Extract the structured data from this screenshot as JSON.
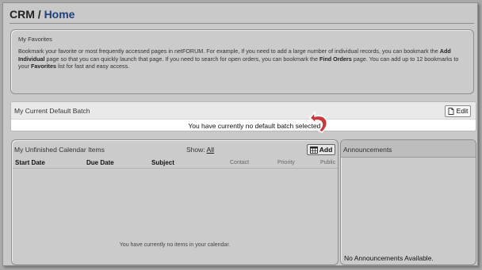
{
  "header": {
    "section": "CRM",
    "separator": " / ",
    "page": "Home"
  },
  "favorites": {
    "title": "My Favorites",
    "desc_1": "Bookmark your favorite or most frequently accessed pages in netFORUM. For example, If you need to add a large number of individual records, you can bookmark the ",
    "desc_add": "Add Individual",
    "desc_2": " page so that you can quickly launch that page. If you need to search for open orders, you can bookmark the ",
    "desc_find": "Find Orders",
    "desc_3": " page. You can add up to 12 bookmarks to your ",
    "desc_fav": "Favorites",
    "desc_4": " list for fast and easy access."
  },
  "batch": {
    "title": "My Current Default Batch",
    "edit_label": "Edit",
    "message": "You have currently no default batch selected."
  },
  "calendar": {
    "title": "My Unfinished Calendar Items",
    "show_label": "Show:",
    "show_value": "All",
    "add_label": "Add",
    "columns": [
      "Start Date",
      "Due Date",
      "Subject",
      "Contact",
      "Priority",
      "Public"
    ],
    "empty_message": "You have currently no items in your calendar."
  },
  "announcements": {
    "title": "Announcements",
    "message": "No Announcements Available."
  },
  "icons": {
    "edit": "document-icon",
    "add": "calendar-icon",
    "pointer": "curved-arrow-icon"
  },
  "colors": {
    "home_link": "#1f3f7a",
    "pointer_arrow": "#c8383b"
  }
}
